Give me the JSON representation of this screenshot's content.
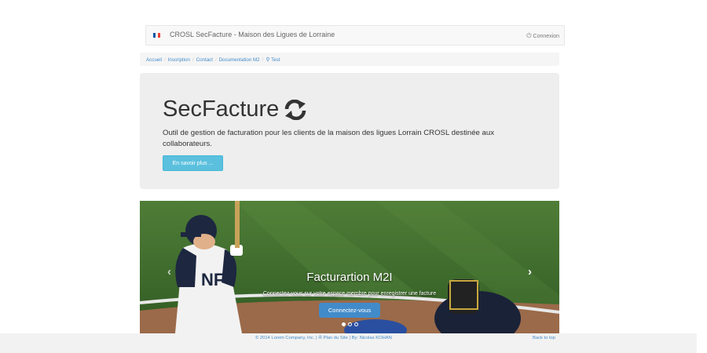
{
  "navbar": {
    "brand": "CROSL SecFacture - Maison des Ligues de Lorraine",
    "connect_label": "Connexion",
    "flag_colors": [
      "#0055a4",
      "#ffffff",
      "#ef4135"
    ]
  },
  "breadcrumb": {
    "items": [
      "Accueil",
      "Inscription",
      "Contact",
      "Documentation M2"
    ],
    "search_label": "Test"
  },
  "jumbotron": {
    "title": "SecFacture",
    "text": "Outil de gestion de facturation pour les clients de la maison des ligues Lorrain CROSL destinée aux collaborateurs.",
    "button_label": "En savoir plus ..."
  },
  "carousel": {
    "caption_title": "Facturartion M2I",
    "caption_text": "Connectez-vous sur votre espace membre pour enregistrer une facture",
    "button_label": "Connectez-vous",
    "prev_glyph": "‹",
    "next_glyph": "›",
    "slide_count": 3,
    "active_index": 0
  },
  "footer": {
    "copyright": "© 2014 Lorem Company, Inc.",
    "plan_link": "Plan du Site",
    "author": "By: Nicolas KOHAN",
    "back_to_top": "Back to top"
  },
  "colors": {
    "accent": "#428bca",
    "info_button": "#5bc0de",
    "jumbotron_bg": "#eeeeee"
  }
}
